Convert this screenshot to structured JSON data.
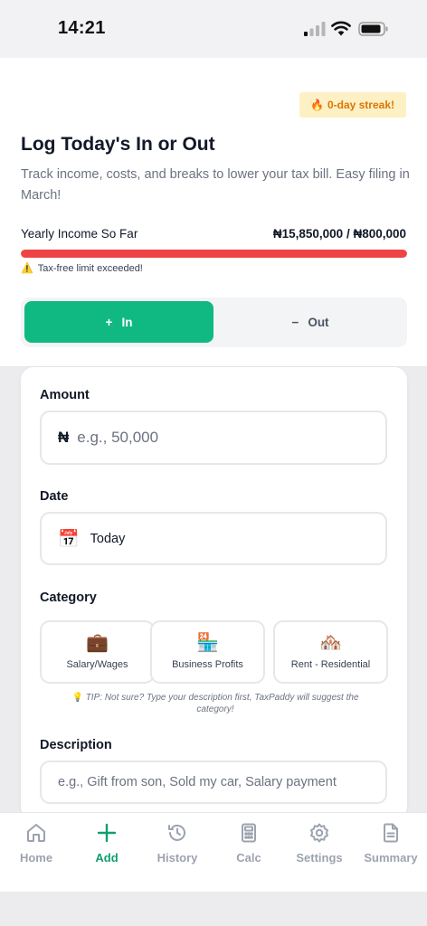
{
  "status": {
    "time": "14:21"
  },
  "streak": {
    "emoji": "🔥",
    "label": "0-day streak!"
  },
  "header": {
    "title": "Log Today's In or Out",
    "subtitle": "Track income, costs, and breaks to lower your tax bill. Easy filing in March!"
  },
  "income": {
    "label": "Yearly Income So Far",
    "value": "₦15,850,000 / ₦800,000",
    "progress_fraction": 1.0,
    "warning_icon": "⚠️",
    "warning": "Tax-free limit exceeded!"
  },
  "toggle": {
    "in_icon": "+",
    "in_label": "In",
    "out_icon": "−",
    "out_label": "Out"
  },
  "form": {
    "amount_label": "Amount",
    "currency_symbol": "₦",
    "amount_placeholder": "e.g., 50,000",
    "date_label": "Date",
    "date_icon": "📅",
    "date_value": "Today",
    "category_label": "Category",
    "categories": [
      {
        "icon": "💼",
        "label": "Salary/Wages"
      },
      {
        "icon": "🏪",
        "label": "Business Profits"
      },
      {
        "icon": "🏘️",
        "label": "Rent - Residential"
      }
    ],
    "tip_icon": "💡",
    "tip": "TIP: Not sure? Type your description first, TaxPaddy will suggest the category!",
    "description_label": "Description",
    "description_placeholder": "e.g., Gift from son, Sold my car, Salary payment"
  },
  "nav": {
    "items": [
      {
        "label": "Home",
        "icon": "home-icon"
      },
      {
        "label": "Add",
        "icon": "plus-icon"
      },
      {
        "label": "History",
        "icon": "history-icon"
      },
      {
        "label": "Calc",
        "icon": "calculator-icon"
      },
      {
        "label": "Settings",
        "icon": "gear-icon"
      },
      {
        "label": "Summary",
        "icon": "document-icon"
      }
    ],
    "active": "Add"
  },
  "colors": {
    "accent": "#10b981",
    "danger": "#ef4444",
    "streak_bg": "#fdf0c4",
    "streak_text": "#d97706"
  }
}
